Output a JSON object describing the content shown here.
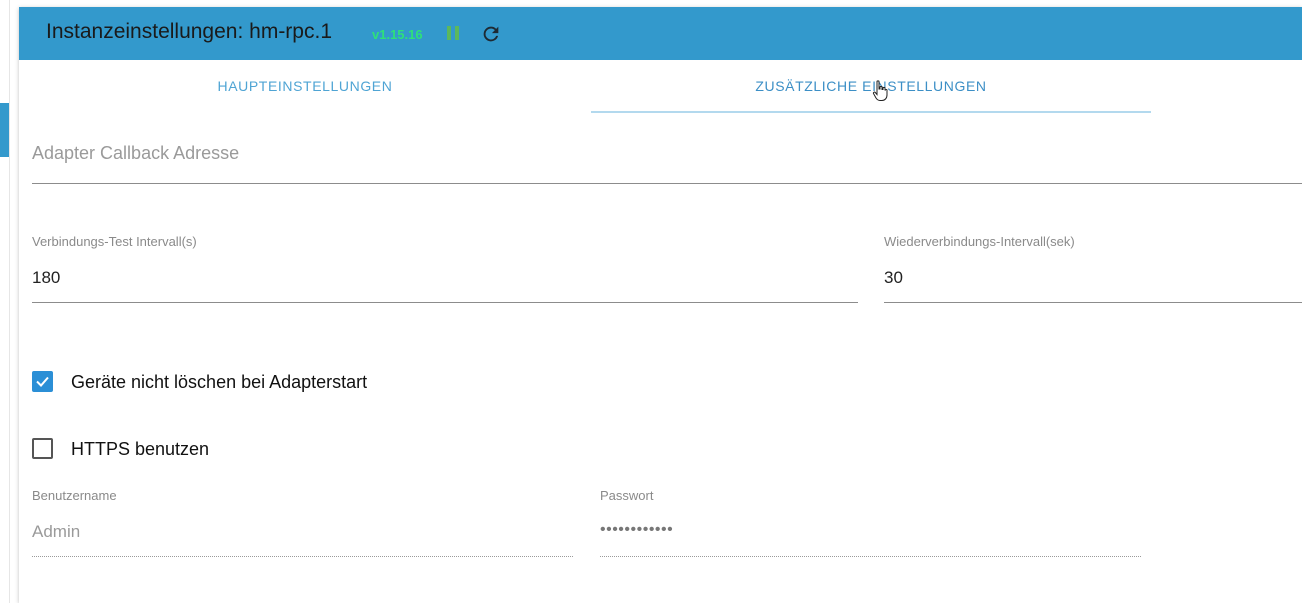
{
  "header": {
    "title": "Instanzeinstellungen: hm-rpc.1",
    "version": "v1.15.16",
    "pause_icon": "pause-icon",
    "reload_icon": "reload-icon"
  },
  "tabs": [
    {
      "label": "HAUPTEINSTELLUNGEN",
      "active": false
    },
    {
      "label": "ZUSÄTZLICHE EINSTELLUNGEN",
      "active": true
    }
  ],
  "form": {
    "callback": {
      "placeholder": "Adapter Callback Adresse",
      "value": ""
    },
    "check_interval": {
      "label": "Verbindungs-Test Intervall(s)",
      "value": "180"
    },
    "reconnect_interval": {
      "label": "Wiederverbindungs-Intervall(sek)",
      "value": "30"
    },
    "dont_delete_devices": {
      "label": "Geräte nicht löschen bei Adapterstart",
      "checked": true
    },
    "use_https": {
      "label": "HTTPS benutzen",
      "checked": false
    },
    "username": {
      "label": "Benutzername",
      "value": "Admin"
    },
    "password": {
      "label": "Passwort",
      "value": "••••••••••••"
    }
  },
  "colors": {
    "header_bg": "#3399cc",
    "version": "#2ee07a",
    "tab_text": "#3c8fc6",
    "checkbox_checked": "#2b8fd6"
  }
}
